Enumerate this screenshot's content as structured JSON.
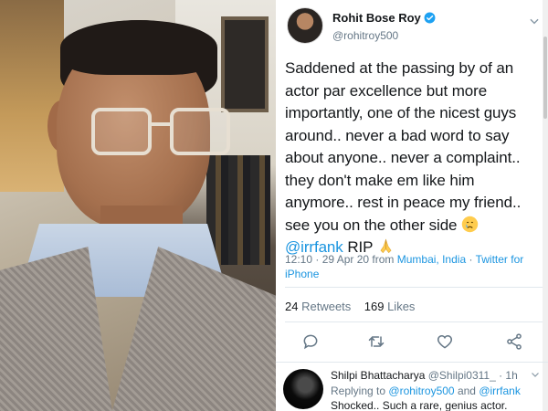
{
  "tweet": {
    "author_name": "Rohit Bose Roy",
    "author_handle": "@rohitroy500",
    "text_line_1": "Saddened at the passing by of an actor par excellence but more importantly, one of the nicest guys around.. never a bad word to say about anyone.. never a complaint.. they don't make em like him anymore.. rest in peace my friend.. see you on the other side",
    "mention": "@irrfank",
    "text_after_mention": "RIP",
    "time": "12:10 · 29 Apr 20 from",
    "location": "Mumbai, India",
    "separator": "·",
    "source": "Twitter for iPhone",
    "retweet_count": "24",
    "retweet_label": "Retweets",
    "like_count": "169",
    "like_label": "Likes"
  },
  "reply": {
    "name": "Shilpi Bhattacharya",
    "handle_time": "@Shilpi0311_ · 1h",
    "replying_prefix": "Replying to",
    "replying_user_1": "@rohitroy500",
    "replying_and": "and",
    "replying_user_2": "@irrfank",
    "text": "Shocked.. Such a rare, genius actor."
  },
  "icons": {
    "verified": "verified-badge-icon",
    "reply": "reply-icon",
    "retweet": "retweet-icon",
    "like": "heart-icon",
    "share": "share-icon",
    "caret": "chevron-down-icon"
  },
  "colors": {
    "link": "#1b95e0",
    "text": "#14171a",
    "muted": "#657786"
  }
}
